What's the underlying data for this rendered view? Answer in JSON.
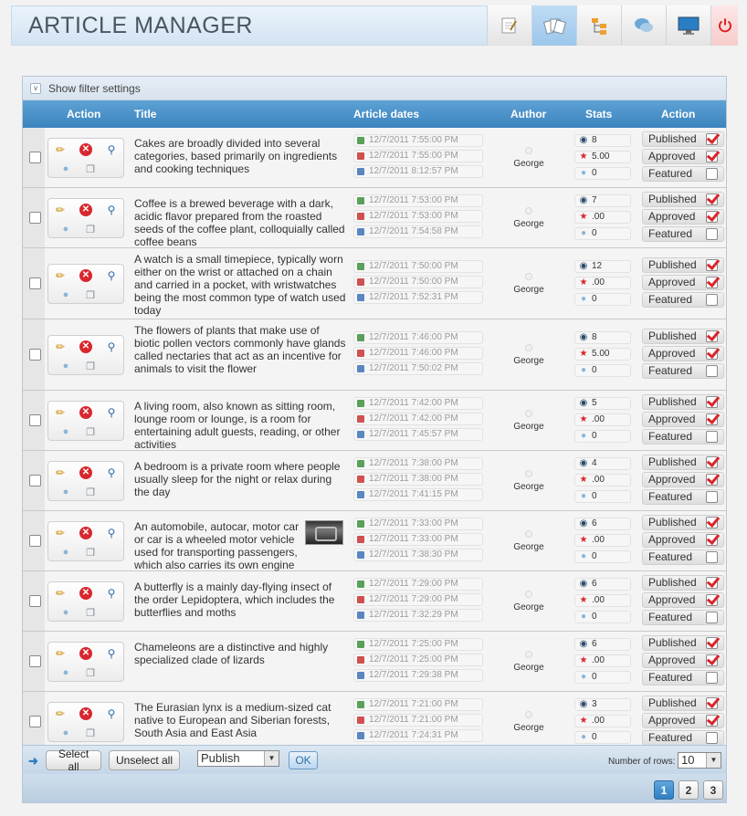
{
  "header": {
    "title": "ARTICLE MANAGER",
    "nav": [
      {
        "name": "edit-article-icon"
      },
      {
        "name": "articles-icon",
        "active": true
      },
      {
        "name": "categories-icon"
      },
      {
        "name": "comments-icon"
      },
      {
        "name": "monitor-icon"
      },
      {
        "name": "power-icon"
      }
    ]
  },
  "filter": {
    "label": "Show filter settings"
  },
  "columns": {
    "action": "Action",
    "title": "Title",
    "dates": "Article dates",
    "author": "Author",
    "stats": "Stats",
    "action2": "Action"
  },
  "labels": {
    "published": "Published",
    "approved": "Approved",
    "featured": "Featured"
  },
  "rows": [
    {
      "title": "Cakes are broadly divided into several categories, based primarily on ingredients and cooking techniques",
      "dates": [
        "12/7/2011 7:55:00 PM",
        "12/7/2011 7:55:00 PM",
        "12/7/2011 8:12:57 PM"
      ],
      "author": "George",
      "views": "8",
      "rating": "5.00",
      "comments": "0",
      "published": true,
      "approved": true,
      "featured": false
    },
    {
      "title": "Coffee is a brewed beverage with a dark, acidic flavor prepared from the roasted seeds of the coffee plant, colloquially called coffee beans",
      "dates": [
        "12/7/2011 7:53:00 PM",
        "12/7/2011 7:53:00 PM",
        "12/7/2011 7:54:58 PM"
      ],
      "author": "George",
      "views": "7",
      "rating": ".00",
      "comments": "0",
      "published": true,
      "approved": true,
      "featured": false
    },
    {
      "title": "A watch is a small timepiece, typically worn either on the wrist or attached on a chain and carried in a pocket, with wristwatches being the most common type of watch used today",
      "dates": [
        "12/7/2011 7:50:00 PM",
        "12/7/2011 7:50:00 PM",
        "12/7/2011 7:52:31 PM"
      ],
      "author": "George",
      "views": "12",
      "rating": ".00",
      "comments": "0",
      "published": true,
      "approved": true,
      "featured": false
    },
    {
      "title": "The flowers of plants that make use of biotic pollen vectors commonly have glands called nectaries that act as an incentive for animals to visit the flower",
      "dates": [
        "12/7/2011 7:46:00 PM",
        "12/7/2011 7:46:00 PM",
        "12/7/2011 7:50:02 PM"
      ],
      "author": "George",
      "views": "8",
      "rating": "5.00",
      "comments": "0",
      "published": true,
      "approved": true,
      "featured": false
    },
    {
      "title": "A living room, also known as sitting room, lounge room or lounge, is a room for entertaining adult guests, reading, or other activities",
      "dates": [
        "12/7/2011 7:42:00 PM",
        "12/7/2011 7:42:00 PM",
        "12/7/2011 7:45:57 PM"
      ],
      "author": "George",
      "views": "5",
      "rating": ".00",
      "comments": "0",
      "published": true,
      "approved": true,
      "featured": false
    },
    {
      "title": "A bedroom is a private room where people usually sleep for the night or relax during the day",
      "dates": [
        "12/7/2011 7:38:00 PM",
        "12/7/2011 7:38:00 PM",
        "12/7/2011 7:41:15 PM"
      ],
      "author": "George",
      "views": "4",
      "rating": ".00",
      "comments": "0",
      "published": true,
      "approved": true,
      "featured": false
    },
    {
      "title": "An automobile, autocar, motor car or car is a wheeled motor vehicle used for transporting passengers, which also carries its own engine or motor",
      "dates": [
        "12/7/2011 7:33:00 PM",
        "12/7/2011 7:33:00 PM",
        "12/7/2011 7:38:30 PM"
      ],
      "author": "George",
      "views": "6",
      "rating": ".00",
      "comments": "0",
      "published": true,
      "approved": true,
      "featured": false,
      "thumb": true
    },
    {
      "title": "A butterfly is a mainly day-flying insect of the order Lepidoptera, which includes the butterflies and moths",
      "dates": [
        "12/7/2011 7:29:00 PM",
        "12/7/2011 7:29:00 PM",
        "12/7/2011 7:32:29 PM"
      ],
      "author": "George",
      "views": "6",
      "rating": ".00",
      "comments": "0",
      "published": true,
      "approved": true,
      "featured": false
    },
    {
      "title": "Chameleons are a distinctive and highly specialized clade of lizards",
      "dates": [
        "12/7/2011 7:25:00 PM",
        "12/7/2011 7:25:00 PM",
        "12/7/2011 7:29:38 PM"
      ],
      "author": "George",
      "views": "6",
      "rating": ".00",
      "comments": "0",
      "published": true,
      "approved": true,
      "featured": false
    },
    {
      "title": "The Eurasian lynx is a medium-sized cat native to European and Siberian forests, South Asia and East Asia",
      "dates": [
        "12/7/2011 7:21:00 PM",
        "12/7/2011 7:21:00 PM",
        "12/7/2011 7:24:31 PM"
      ],
      "author": "George",
      "views": "3",
      "rating": ".00",
      "comments": "0",
      "published": true,
      "approved": true,
      "featured": false
    }
  ],
  "bottombar": {
    "select_all": "Select all",
    "unselect_all": "Unselect all",
    "bulk_action": "Publish",
    "ok": "OK",
    "rows_label": "Number of rows:",
    "rows_value": "10"
  },
  "pagination": {
    "pages": [
      "1",
      "2",
      "3"
    ],
    "current": "1"
  }
}
